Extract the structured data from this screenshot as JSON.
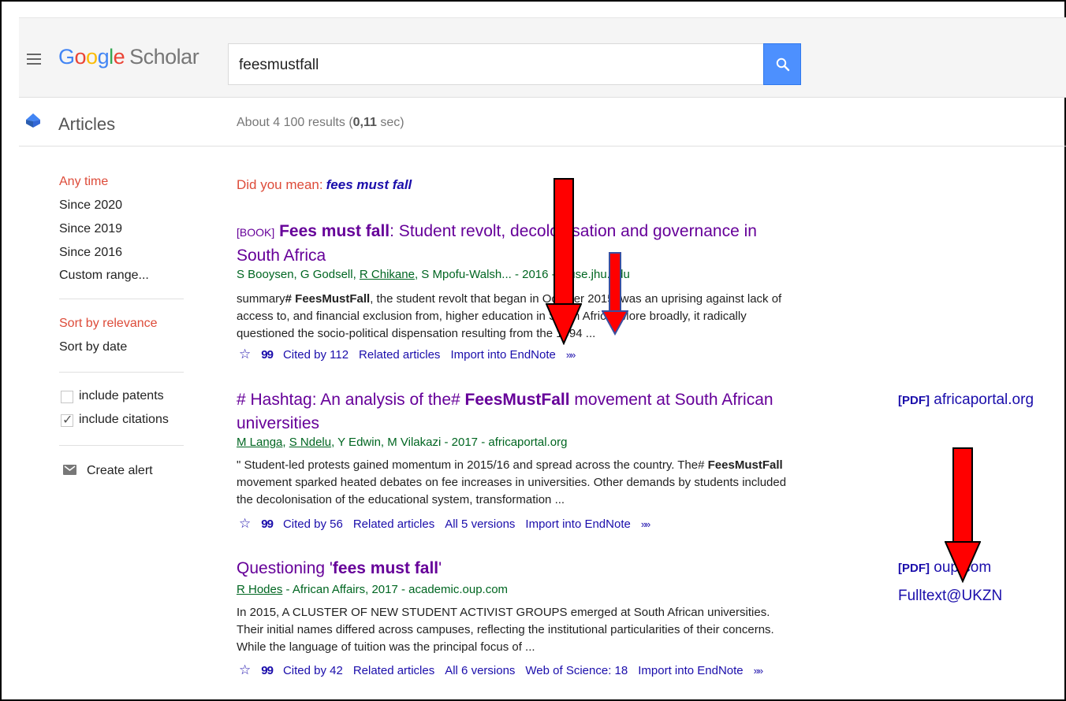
{
  "header": {
    "logo_google": [
      "G",
      "o",
      "o",
      "g",
      "l",
      "e"
    ],
    "logo_scholar": "Scholar",
    "search_value": "feesmustfall"
  },
  "bar": {
    "section": "Articles",
    "results_prefix": "About 4 100 results (",
    "results_time": "0,11",
    "results_suffix": " sec)"
  },
  "sidebar": {
    "time_filters": [
      "Any time",
      "Since 2020",
      "Since 2019",
      "Since 2016",
      "Custom range..."
    ],
    "sort": [
      "Sort by relevance",
      "Sort by date"
    ],
    "include_patents": "include patents",
    "include_citations": "include citations",
    "create_alert": "Create alert"
  },
  "did_you_mean": {
    "prefix": "Did you mean:",
    "suggestion": "fees must fall"
  },
  "results": [
    {
      "tag": "[BOOK]",
      "title_bold": "Fees must fall",
      "title_rest": ": Student revolt, decolonisation and governance in South Africa",
      "authors": [
        "S Booysen, G Godsell, ",
        "R Chikane",
        ", S Mpofu-Walsh... - 2016 - muse.jhu.edu"
      ],
      "snippet_a": "summary",
      "snippet_bold": "# FeesMustFall",
      "snippet_b": ", the student revolt that began in October 2015, was an uprising against lack of access to, and financial exclusion from, higher education in South Africa. More broadly, it radically questioned the socio-political dispensation resulting from the 1994 ...",
      "links": [
        "Cited by 112",
        "Related articles",
        "Import into EndNote"
      ],
      "side_tag": "",
      "side_link": ""
    },
    {
      "title_a": "# Hashtag: An analysis of the# ",
      "title_bold": "FeesMustFall",
      "title_b": " movement at South African universities",
      "authors": [
        "M Langa",
        ", ",
        "S Ndelu",
        ", Y Edwin, M Vilakazi - 2017 - africaportal.org"
      ],
      "snippet_a": "\" Student-led protests gained momentum in 2015/16 and spread across the country. The# ",
      "snippet_bold": "FeesMustFall",
      "snippet_b": " movement sparked heated debates on fee increases in universities. Other demands by students included the decolonisation of the educational system, transformation ...",
      "links": [
        "Cited by 56",
        "Related articles",
        "All 5 versions",
        "Import into EndNote"
      ],
      "side_tag": "[PDF]",
      "side_link": "africaportal.org"
    },
    {
      "title_a": "Questioning '",
      "title_bold": "fees must fall",
      "title_b": "'",
      "authors": [
        "R Hodes",
        " - African Affairs, 2017 - academic.oup.com"
      ],
      "snippet": "In 2015, A CLUSTER OF NEW STUDENT ACTIVIST GROUPS emerged at South African universities. Their initial names differed across campuses, reflecting the institutional particularities of their concerns. While the language of tuition was the principal focus of ...",
      "links": [
        "Cited by 42",
        "Related articles",
        "All 6 versions",
        "Web of Science: 18",
        "Import into EndNote"
      ],
      "side_tag": "[PDF]",
      "side_link": "oup.com",
      "side_link2": "Fulltext@UKZN"
    }
  ],
  "icons": {
    "star": "star-icon",
    "quote": "cite-icon",
    "more": "more-icon"
  },
  "colors": {
    "link": "#1a0dab",
    "visited_title": "#660099",
    "author_green": "#006621",
    "filter_red": "#dd4b39",
    "search_button": "#4d90fe",
    "annotation_arrow": "#ff0000"
  }
}
